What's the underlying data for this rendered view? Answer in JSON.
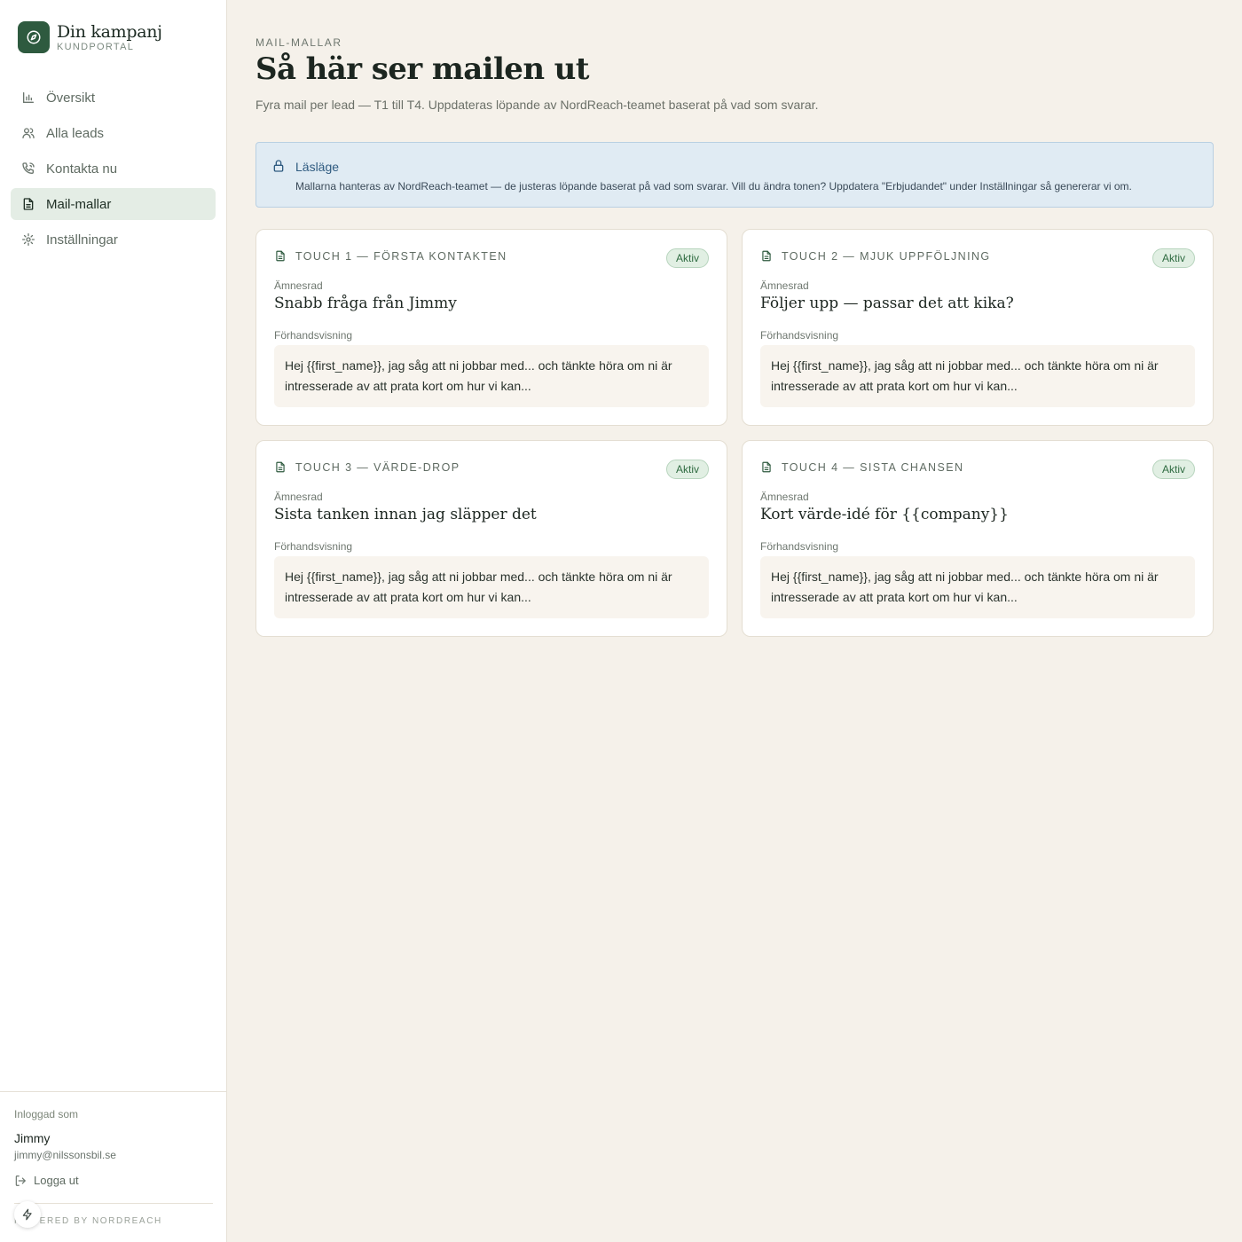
{
  "brand": {
    "title": "Din kampanj",
    "subtitle": "KUNDPORTAL"
  },
  "nav": {
    "items": [
      {
        "label": "Översikt",
        "icon": "bar-chart-icon"
      },
      {
        "label": "Alla leads",
        "icon": "users-icon"
      },
      {
        "label": "Kontakta nu",
        "icon": "phone-icon"
      },
      {
        "label": "Mail-mallar",
        "icon": "document-icon",
        "active": true
      },
      {
        "label": "Inställningar",
        "icon": "gear-icon"
      }
    ]
  },
  "account": {
    "logged_in_label": "Inloggad som",
    "name": "Jimmy",
    "email": "jimmy@nilssonsbil.se",
    "logout_label": "Logga ut",
    "powered_by": "POWERED BY NORDREACH"
  },
  "header": {
    "eyebrow": "MAIL-MALLAR",
    "title": "Så här ser mailen ut",
    "subtitle": "Fyra mail per lead — T1 till T4. Uppdateras löpande av NordReach-teamet baserat på vad som svarar."
  },
  "notice": {
    "title": "Läsläge",
    "text": "Mallarna hanteras av NordReach-teamet — de justeras löpande baserat på vad som svarar. Vill du ändra tonen? Uppdatera \"Erbjudandet\" under Inställningar så genererar vi om."
  },
  "templates": [
    {
      "touch": "TOUCH 1 — FÖRSTA KONTAKTEN",
      "status": "Aktiv",
      "subject_label": "Ämnesrad",
      "subject": "Snabb fråga från Jimmy",
      "preview_label": "Förhandsvisning",
      "preview": "Hej {{first_name}}, jag såg att ni jobbar med... och tänkte höra om ni är intresserade av att prata kort om hur vi kan..."
    },
    {
      "touch": "TOUCH 2 — MJUK UPPFÖLJNING",
      "status": "Aktiv",
      "subject_label": "Ämnesrad",
      "subject": "Följer upp — passar det att kika?",
      "preview_label": "Förhandsvisning",
      "preview": "Hej {{first_name}}, jag såg att ni jobbar med... och tänkte höra om ni är intresserade av att prata kort om hur vi kan..."
    },
    {
      "touch": "TOUCH 3 — VÄRDE-DROP",
      "status": "Aktiv",
      "subject_label": "Ämnesrad",
      "subject": "Sista tanken innan jag släpper det",
      "preview_label": "Förhandsvisning",
      "preview": "Hej {{first_name}}, jag såg att ni jobbar med... och tänkte höra om ni är intresserade av att prata kort om hur vi kan..."
    },
    {
      "touch": "TOUCH 4 — SISTA CHANSEN",
      "status": "Aktiv",
      "subject_label": "Ämnesrad",
      "subject": "Kort värde-idé för {{company}}",
      "preview_label": "Förhandsvisning",
      "preview": "Hej {{first_name}}, jag såg att ni jobbar med... och tänkte höra om ni är intresserade av att prata kort om hur vi kan..."
    }
  ],
  "colors": {
    "accent": "#2e5a3f",
    "background": "#f5f1ea",
    "notice_bg": "#e0ebf3",
    "badge_bg": "#e1efe3"
  }
}
